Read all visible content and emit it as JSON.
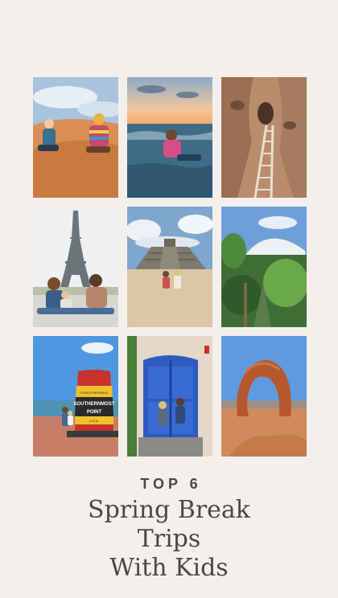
{
  "photos": [
    {
      "subject": "kids-on-sand-dunes"
    },
    {
      "subject": "child-in-ocean-sunset"
    },
    {
      "subject": "slot-canyon-ladder"
    },
    {
      "subject": "family-eiffel-tower"
    },
    {
      "subject": "chichen-itza-pyramid"
    },
    {
      "subject": "tropical-garden-volcano"
    },
    {
      "subject": "southernmost-point-buoy"
    },
    {
      "subject": "kids-blue-doors"
    },
    {
      "subject": "delicate-arch"
    }
  ],
  "buoy_text": {
    "top": "CONCH REPUBLIC",
    "main": "SOUTHERNMOST",
    "sub": "POINT",
    "bottom": "U.S.A."
  },
  "caption": {
    "kicker": "TOP 6",
    "line1": "Spring Break",
    "line2": "Trips",
    "line3": "With Kids"
  },
  "colors": {
    "background": "#f3f0ec",
    "text": "#4a4744"
  }
}
